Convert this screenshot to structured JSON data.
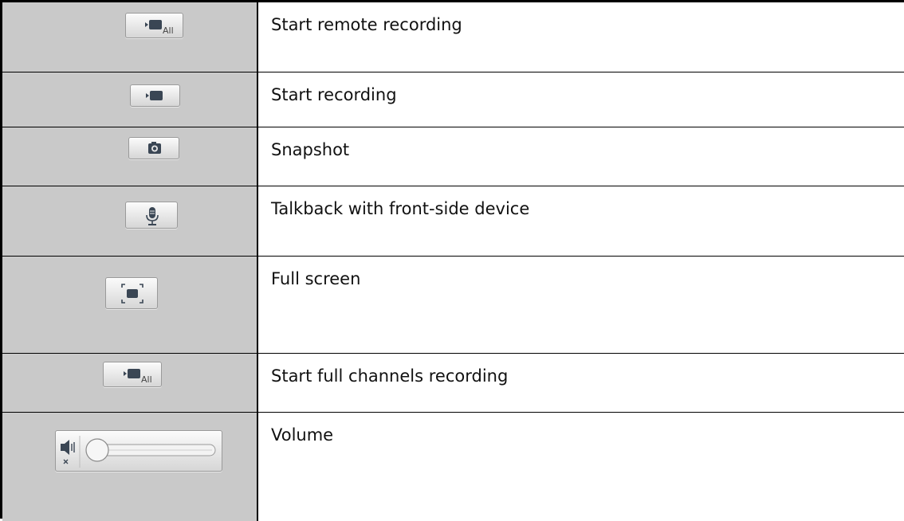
{
  "rows": [
    {
      "icon": "record-all-icon",
      "description": "Start remote recording",
      "icon_text": "All"
    },
    {
      "icon": "record-icon",
      "description": "Start recording"
    },
    {
      "icon": "camera-icon",
      "description": "Snapshot"
    },
    {
      "icon": "microphone-icon",
      "description": "Talkback with front-side device"
    },
    {
      "icon": "fullscreen-icon",
      "description": "Full screen"
    },
    {
      "icon": "record-all-icon",
      "description": "Start full channels recording",
      "icon_text": "All"
    },
    {
      "icon": "volume-slider-icon",
      "description": "Volume",
      "volume_level": 0
    }
  ],
  "colors": {
    "icon_cell_bg": "#c9c9c9",
    "border": "#000000",
    "icon_color": "#3a4654"
  }
}
